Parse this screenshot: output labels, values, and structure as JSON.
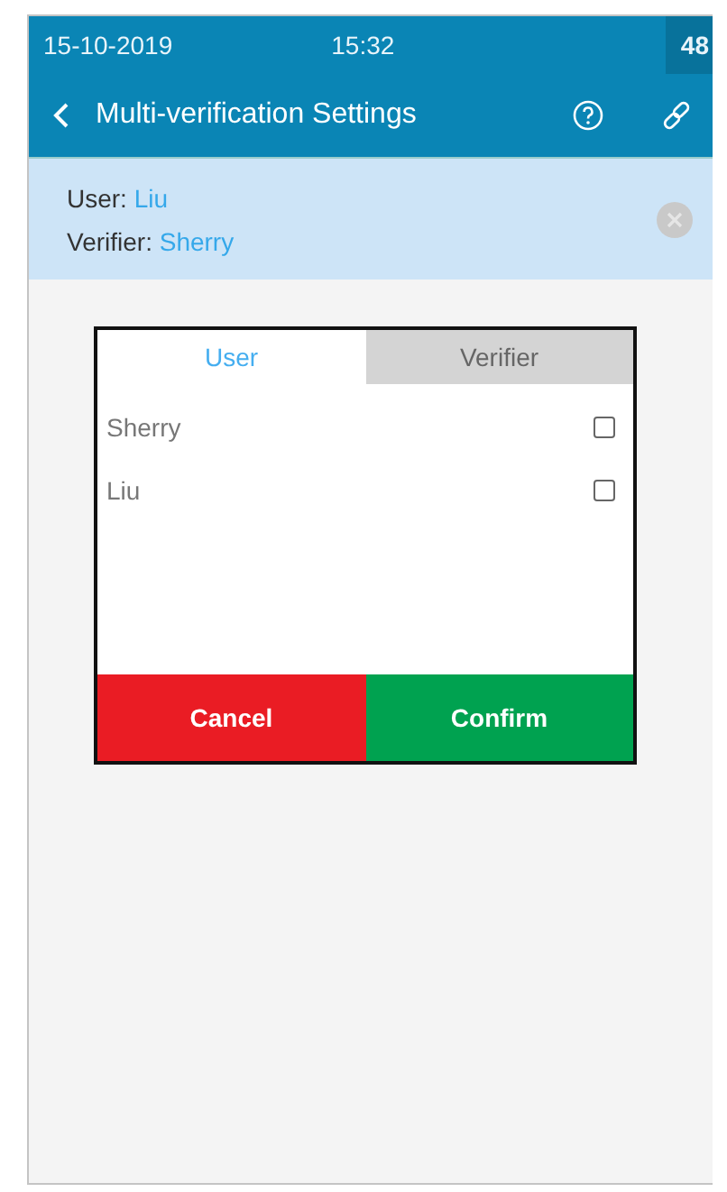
{
  "status_bar": {
    "date": "15-10-2019",
    "time": "15:32",
    "battery": "48"
  },
  "header": {
    "title": "Multi-verification Settings"
  },
  "summary": {
    "user_label": "User:",
    "user": "Liu",
    "verifier_label": "Verifier:",
    "verifier": "Sherry"
  },
  "dialog": {
    "tabs": [
      {
        "label": "User",
        "selected": true
      },
      {
        "label": "Verifier",
        "selected": false
      }
    ],
    "items": [
      {
        "name": "Sherry",
        "checked": false
      },
      {
        "name": "Liu",
        "checked": false
      }
    ],
    "buttons": [
      {
        "label": "Cancel",
        "kind": "cancel"
      },
      {
        "label": "Confirm",
        "kind": "confirm"
      }
    ]
  }
}
